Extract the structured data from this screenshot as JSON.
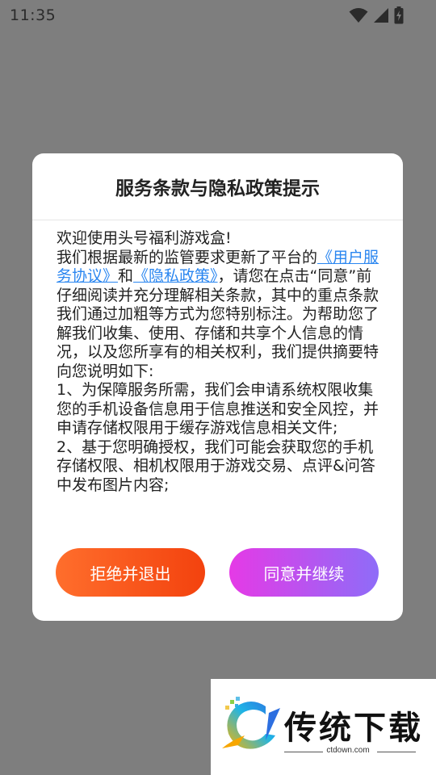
{
  "status_bar": {
    "time": "11:35"
  },
  "dialog": {
    "title": "服务条款与隐私政策提示",
    "greeting": "欢迎使用头号福利游戏盒!",
    "intro_before": "我们根据最新的监管要求更新了平台的",
    "link_user_agreement": "《用户服务协议》",
    "and_text": "和",
    "link_privacy_policy": "《隐私政策》",
    "intro_after": "，请您在点击“同意”前仔细阅读并充分理解相关条款，其中的重点条款我们通过加粗等方式为您特别标注。为帮助您了解我们收集、使用、存储和共享个人信息的情况，以及您所享有的相关权利，我们提供摘要特向您说明如下:",
    "item1": "1、为保障服务所需，我们会申请系统权限收集您的手机设备信息用于信息推送和安全风控，并申请存储权限用于缓存游戏信息相关文件;",
    "item2": "2、基于您明确授权，我们可能会获取您的手机存储权限、相机权限用于游戏交易、点评&问答中发布图片内容;",
    "reject_label": "拒绝并退出",
    "agree_label": "同意并继续"
  },
  "watermark": {
    "name": "传统下载",
    "url": "ctdown.com"
  },
  "colors": {
    "overlay": "#7e7e7e",
    "link": "#2a86f0",
    "reject_gradient": [
      "#ff6e2c",
      "#f3420e"
    ],
    "agree_gradient": [
      "#e53ae6",
      "#8e6cf8"
    ]
  }
}
